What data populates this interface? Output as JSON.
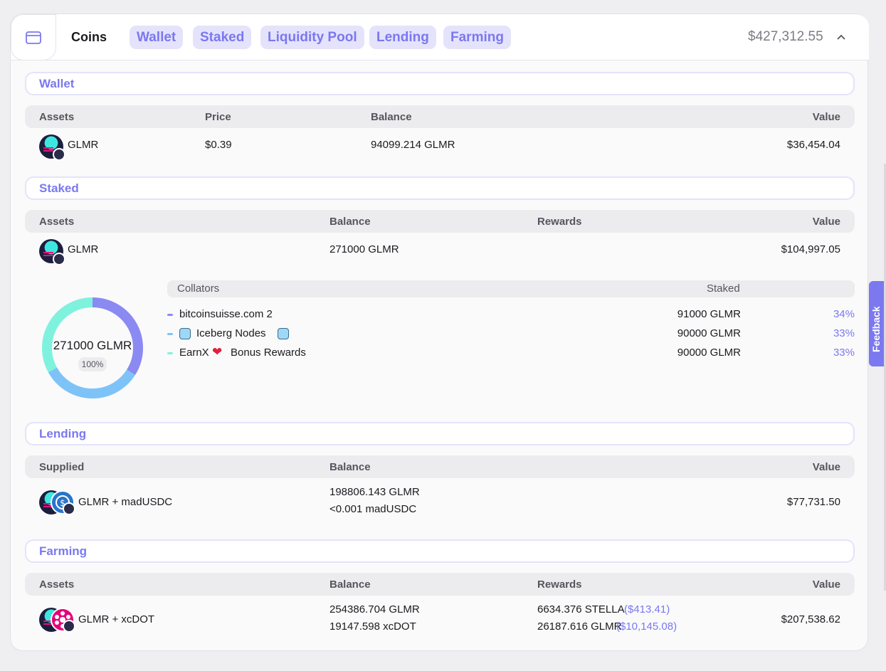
{
  "header": {
    "title": "Coins",
    "tabs": [
      "Wallet",
      "Staked",
      "Liquidity Pool",
      "Lending",
      "Farming"
    ],
    "total": "$427,312.55"
  },
  "wallet": {
    "label": "Wallet",
    "columns": [
      "Assets",
      "Price",
      "Balance",
      "Value"
    ],
    "row": {
      "asset": "GLMR",
      "price": "$0.39",
      "balance": "94099.214 GLMR",
      "value": "$36,454.04"
    }
  },
  "staked": {
    "label": "Staked",
    "columns": [
      "Assets",
      "Balance",
      "Rewards",
      "Value"
    ],
    "row": {
      "asset": "GLMR",
      "balance": "271000 GLMR",
      "value": "$104,997.05"
    },
    "donut": {
      "total": "271000 GLMR",
      "pct": "100%"
    },
    "collators_header": {
      "name": "Collators",
      "staked": "Staked"
    },
    "collators": [
      {
        "name": "bitcoinsuisse.com 2",
        "staked": "91000 GLMR",
        "pct": "34%",
        "share": 0.34,
        "color": "#8b89f2"
      },
      {
        "name": "Iceberg Nodes",
        "staked": "90000 GLMR",
        "pct": "33%",
        "share": 0.33,
        "color": "#7ec3f7"
      },
      {
        "name_a": "EarnX",
        "name_b": "Bonus Rewards",
        "staked": "90000 GLMR",
        "pct": "33%",
        "share": 0.33,
        "color": "#7ff2de"
      }
    ]
  },
  "lending": {
    "label": "Lending",
    "columns": [
      "Supplied",
      "Balance",
      "Value"
    ],
    "row": {
      "asset": "GLMR + madUSDC",
      "balance_1": "198806.143 GLMR",
      "balance_2": "<0.001 madUSDC",
      "value": "$77,731.50"
    }
  },
  "farming": {
    "label": "Farming",
    "columns": [
      "Assets",
      "Balance",
      "Rewards",
      "Value"
    ],
    "row": {
      "asset": "GLMR + xcDOT",
      "balance_1": "254386.704 GLMR",
      "balance_2": "19147.598 xcDOT",
      "reward_1": "6634.376 STELLA",
      "reward_1_usd": "($413.41)",
      "reward_2": "26187.616 GLMR",
      "reward_2_usd": "($10,145.08)",
      "value": "$207,538.62"
    }
  },
  "feedback": {
    "label": "Feedback"
  },
  "colors": {
    "accent": "#7b78f0",
    "glmr": "#3de7e0"
  }
}
